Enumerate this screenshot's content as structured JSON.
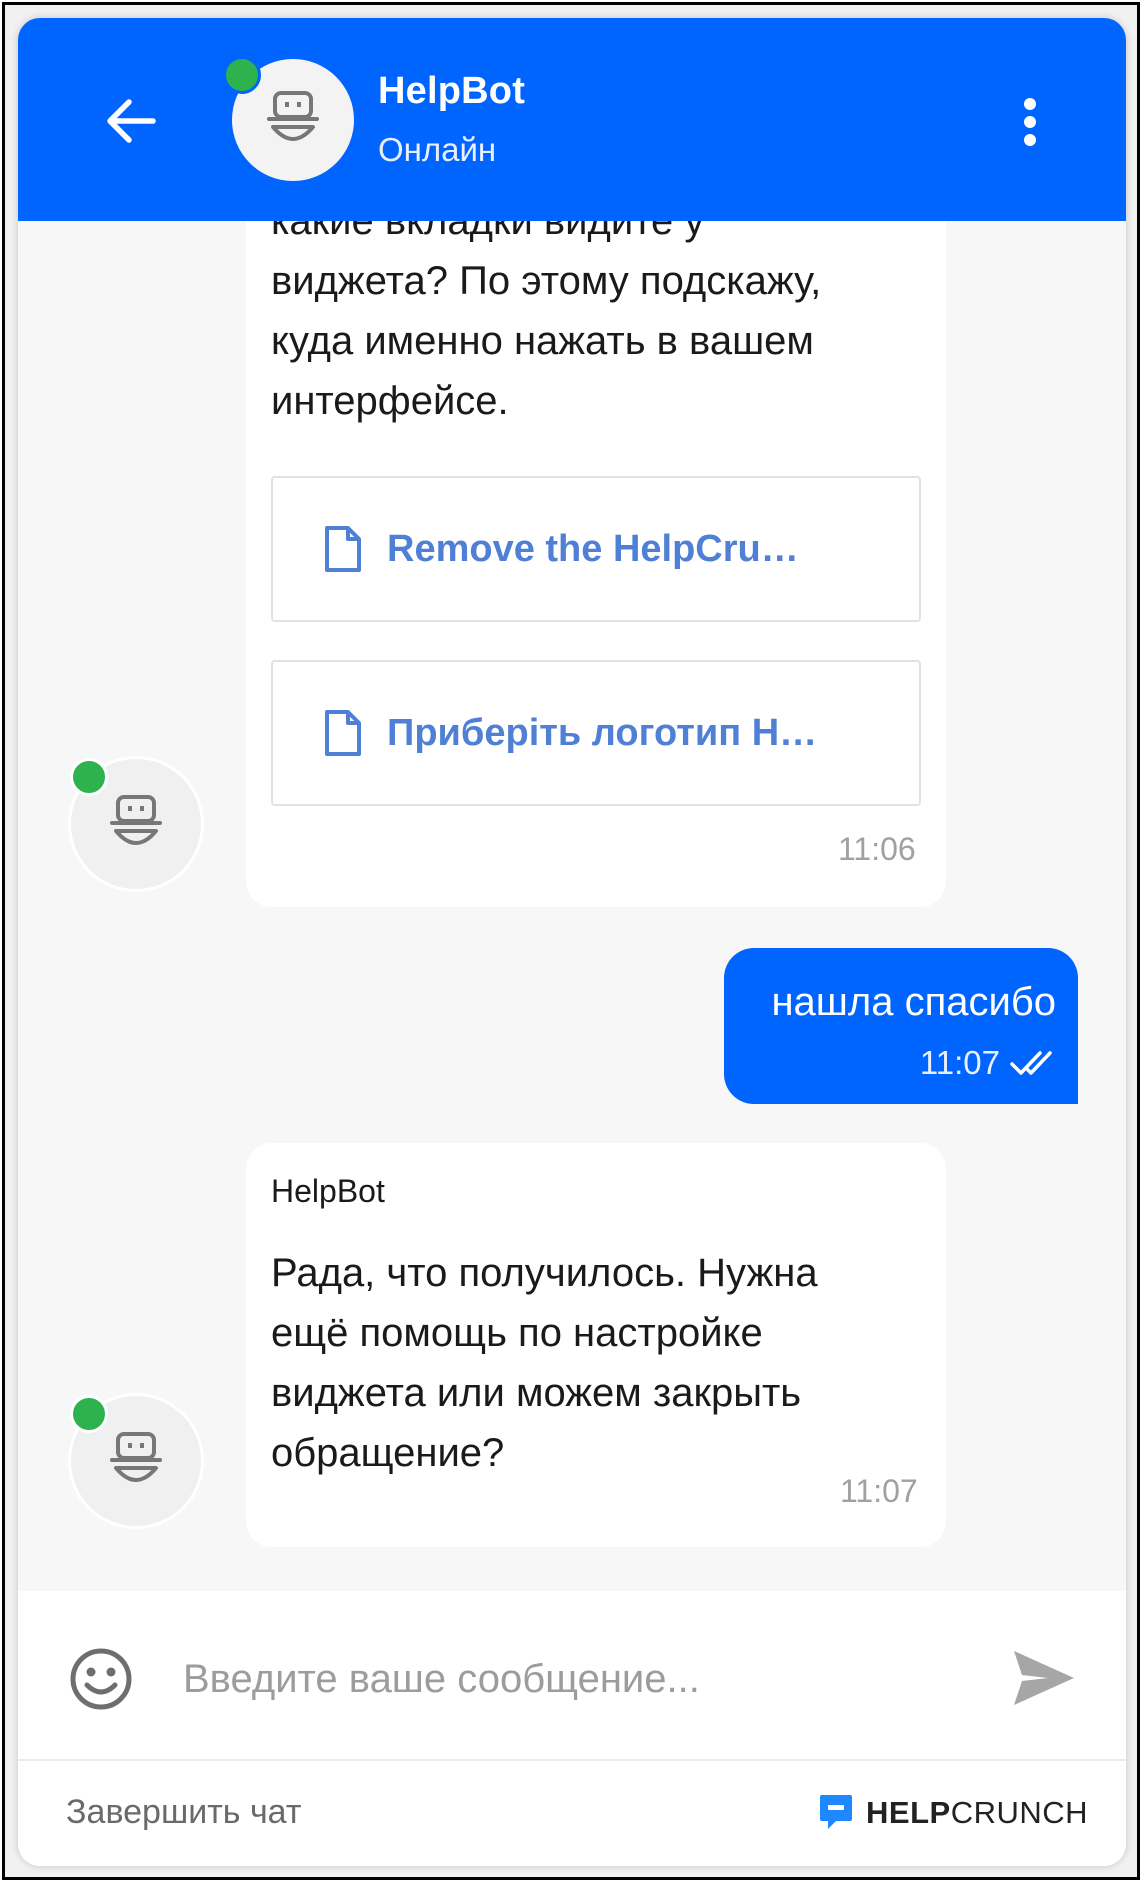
{
  "header": {
    "bot_name": "HelpBot",
    "status": "Онлайн",
    "accent": "#0064ff",
    "online_color": "#2db24e",
    "back_icon": "arrow-left-icon",
    "menu_icon": "more-vertical-icon"
  },
  "messages": [
    {
      "from": "bot",
      "text_lines": [
        "какие вкладки видите у",
        "виджета? По этому подскажу,",
        "куда именно нажать в вашем",
        "интерфейсе."
      ],
      "articles": [
        {
          "title": "Remove the HelpCru…",
          "icon": "document-icon"
        },
        {
          "title": "Приберіть логотип H…",
          "icon": "document-icon"
        }
      ],
      "time": "11:06"
    },
    {
      "from": "user",
      "text": "нашла спасибо",
      "time": "11:07",
      "read_icon": "double-check-icon"
    },
    {
      "from": "bot",
      "sender": "HelpBot",
      "text_lines": [
        "Рада, что получилось. Нужна",
        "ещё помощь по настройке",
        "виджета или можем закрыть",
        "обращение?"
      ],
      "time": "11:07"
    }
  ],
  "composer": {
    "placeholder": "Введите ваше сообщение...",
    "emoji_icon": "smiley-icon",
    "send_icon": "send-icon"
  },
  "footer": {
    "end_chat": "Завершить чат",
    "brand_bold": "HELP",
    "brand_rest": "CRUNCH"
  }
}
